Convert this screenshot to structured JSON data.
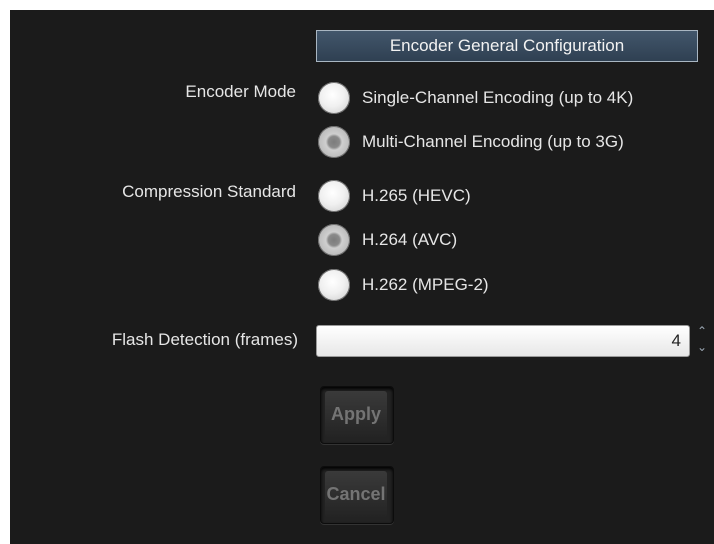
{
  "header": {
    "title": "Encoder General Configuration"
  },
  "encoder_mode": {
    "label": "Encoder Mode",
    "options": [
      {
        "label": "Single-Channel Encoding (up to 4K)",
        "selected": false
      },
      {
        "label": "Multi-Channel Encoding (up to 3G)",
        "selected": true
      }
    ]
  },
  "compression": {
    "label": "Compression Standard",
    "options": [
      {
        "label": "H.265 (HEVC)",
        "selected": false
      },
      {
        "label": "H.264 (AVC)",
        "selected": true
      },
      {
        "label": "H.262 (MPEG-2)",
        "selected": false
      }
    ]
  },
  "flash_detection": {
    "label": "Flash Detection (frames)",
    "value": "4"
  },
  "buttons": {
    "apply": "Apply",
    "cancel": "Cancel"
  },
  "icons": {
    "spinner": "spinner-arrows-icon"
  },
  "colors": {
    "background": "#1b1b1b",
    "header": "#3a4c5f",
    "text": "#e6e6e6"
  }
}
